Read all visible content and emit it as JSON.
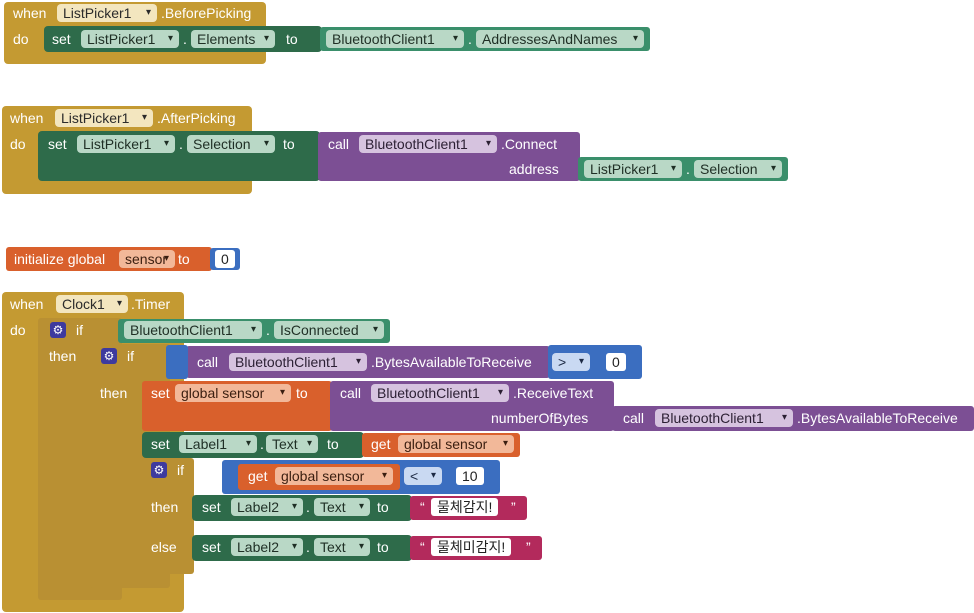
{
  "kw": {
    "when": "when",
    "do": "do",
    "set": "set",
    "to": "to",
    "call": "call",
    "get": "get",
    "if": "if",
    "then": "then",
    "else": "else",
    "dot": ".",
    "address": "address",
    "numberOfBytes": "numberOfBytes",
    "initialize_global": "initialize global"
  },
  "comp": {
    "listpicker": "ListPicker1",
    "bt": "BluetoothClient1",
    "clock": "Clock1",
    "label1": "Label1",
    "label2": "Label2"
  },
  "ev": {
    "before": ".BeforePicking",
    "after": ".AfterPicking",
    "timer": ".Timer"
  },
  "prop": {
    "elements": "Elements",
    "selection": "Selection",
    "addrnames": "AddressesAndNames",
    "isconnected": "IsConnected",
    "text": "Text"
  },
  "method": {
    "connect": ".Connect",
    "bytesavail": ".BytesAvailableToReceive",
    "receivetext": ".ReceiveText"
  },
  "var": {
    "sensor": "sensor",
    "global_sensor": "global sensor"
  },
  "ops": {
    "gt": ">",
    "lt": "<"
  },
  "nums": {
    "zero": "0",
    "ten": "10"
  },
  "strings": {
    "detected": "물체감지!",
    "not_detected": "물체미감지!",
    "quote_open": "“",
    "quote_close": "”"
  }
}
